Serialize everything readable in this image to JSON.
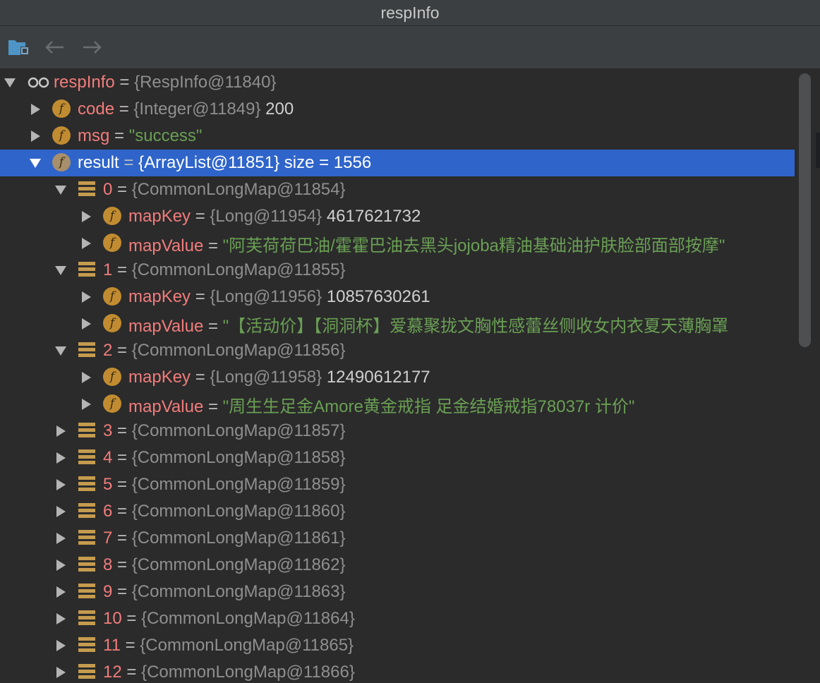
{
  "window": {
    "title": "respInfo"
  },
  "toolbar": {
    "buttons": [
      {
        "icon": "frames-icon"
      },
      {
        "icon": "back-arrow-icon"
      },
      {
        "icon": "forward-arrow-icon"
      }
    ]
  },
  "tree": {
    "rows": [
      {
        "depth": 0,
        "expanded": true,
        "icon": "watch",
        "name": "respInfo",
        "type": "{RespInfo@11840}"
      },
      {
        "depth": 1,
        "expanded": false,
        "icon": "field",
        "name": "code",
        "type": "{Integer@11849}",
        "value": "200"
      },
      {
        "depth": 1,
        "expanded": false,
        "icon": "field",
        "name": "msg",
        "str": "\"success\""
      },
      {
        "depth": 1,
        "expanded": true,
        "icon": "field",
        "name": "result",
        "type": "{ArrayList@11851}",
        "value": " size = 1556",
        "selected": true
      },
      {
        "depth": 2,
        "expanded": true,
        "icon": "list",
        "name": "0",
        "type": "{CommonLongMap@11854}"
      },
      {
        "depth": 3,
        "expanded": false,
        "icon": "field",
        "name": "mapKey",
        "type": "{Long@11954}",
        "value": "4617621732"
      },
      {
        "depth": 3,
        "expanded": false,
        "icon": "field",
        "name": "mapValue",
        "str": "\"阿芙荷荷巴油/霍霍巴油去黑头jojoba精油基础油护肤脸部面部按摩\""
      },
      {
        "depth": 2,
        "expanded": true,
        "icon": "list",
        "name": "1",
        "type": "{CommonLongMap@11855}"
      },
      {
        "depth": 3,
        "expanded": false,
        "icon": "field",
        "name": "mapKey",
        "type": "{Long@11956}",
        "value": "10857630261"
      },
      {
        "depth": 3,
        "expanded": false,
        "icon": "field",
        "name": "mapValue",
        "str": "\"【活动价】【洞洞杯】爱慕聚拢文胸性感蕾丝侧收女内衣夏天薄胸罩"
      },
      {
        "depth": 2,
        "expanded": true,
        "icon": "list",
        "name": "2",
        "type": "{CommonLongMap@11856}"
      },
      {
        "depth": 3,
        "expanded": false,
        "icon": "field",
        "name": "mapKey",
        "type": "{Long@11958}",
        "value": "12490612177"
      },
      {
        "depth": 3,
        "expanded": false,
        "icon": "field",
        "name": "mapValue",
        "str": "\"周生生足金Amore黄金戒指 足金结婚戒指78037r  计价\""
      },
      {
        "depth": 2,
        "expanded": false,
        "icon": "list",
        "name": "3",
        "type": "{CommonLongMap@11857}"
      },
      {
        "depth": 2,
        "expanded": false,
        "icon": "list",
        "name": "4",
        "type": "{CommonLongMap@11858}"
      },
      {
        "depth": 2,
        "expanded": false,
        "icon": "list",
        "name": "5",
        "type": "{CommonLongMap@11859}"
      },
      {
        "depth": 2,
        "expanded": false,
        "icon": "list",
        "name": "6",
        "type": "{CommonLongMap@11860}"
      },
      {
        "depth": 2,
        "expanded": false,
        "icon": "list",
        "name": "7",
        "type": "{CommonLongMap@11861}"
      },
      {
        "depth": 2,
        "expanded": false,
        "icon": "list",
        "name": "8",
        "type": "{CommonLongMap@11862}"
      },
      {
        "depth": 2,
        "expanded": false,
        "icon": "list",
        "name": "9",
        "type": "{CommonLongMap@11863}"
      },
      {
        "depth": 2,
        "expanded": false,
        "icon": "list",
        "name": "10",
        "type": "{CommonLongMap@11864}"
      },
      {
        "depth": 2,
        "expanded": false,
        "icon": "list",
        "name": "11",
        "type": "{CommonLongMap@11865}"
      },
      {
        "depth": 2,
        "expanded": false,
        "icon": "list",
        "name": "12",
        "type": "{CommonLongMap@11866}"
      }
    ]
  }
}
